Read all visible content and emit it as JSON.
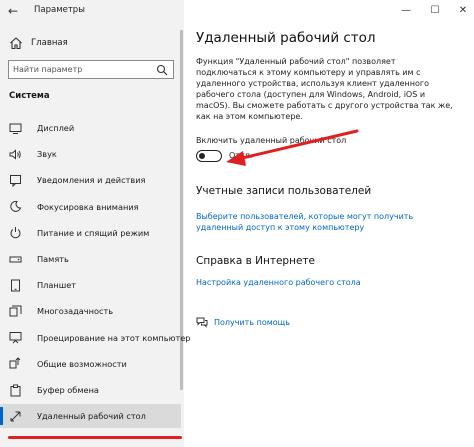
{
  "window": {
    "title": "Параметры",
    "minimize": "—",
    "maximize": "☐",
    "close": "✕"
  },
  "sidebar": {
    "home_label": "Главная",
    "search_placeholder": "Найти параметр",
    "section_title": "Система",
    "items": [
      {
        "label": "Дисплей",
        "icon": "display-icon"
      },
      {
        "label": "Звук",
        "icon": "sound-icon"
      },
      {
        "label": "Уведомления и действия",
        "icon": "notifications-icon"
      },
      {
        "label": "Фокусировка внимания",
        "icon": "focus-assist-icon"
      },
      {
        "label": "Питание и спящий режим",
        "icon": "power-icon"
      },
      {
        "label": "Память",
        "icon": "storage-icon"
      },
      {
        "label": "Планшет",
        "icon": "tablet-icon"
      },
      {
        "label": "Многозадачность",
        "icon": "multitasking-icon"
      },
      {
        "label": "Проецирование на этот компьютер",
        "icon": "projecting-icon"
      },
      {
        "label": "Общие возможности",
        "icon": "shared-experiences-icon"
      },
      {
        "label": "Буфер обмена",
        "icon": "clipboard-icon"
      },
      {
        "label": "Удаленный рабочий стол",
        "icon": "remote-desktop-icon",
        "active": true
      }
    ]
  },
  "main": {
    "title": "Удаленный рабочий стол",
    "description": "Функция \"Удаленный рабочий стол\" позволяет подключаться к этому компьютеру и управлять им с удаленного устройства, используя клиент удаленного рабочего стола (доступен для Windows, Android, iOS и macOS). Вы сможете работать с другого устройства так же, как на этом компьютере.",
    "toggle_label": "Включить удаленный рабочий стол",
    "toggle_state": "Откл.",
    "accounts_heading": "Учетные записи пользователей",
    "accounts_link": "Выберите пользователей, которые могут получить удаленный доступ к этому компьютеру",
    "help_heading": "Справка в Интернете",
    "help_link": "Настройка удаленного рабочего стола",
    "get_help": "Получить помощь"
  },
  "colors": {
    "accent": "#0067c0",
    "annotation_red": "#e02020"
  }
}
